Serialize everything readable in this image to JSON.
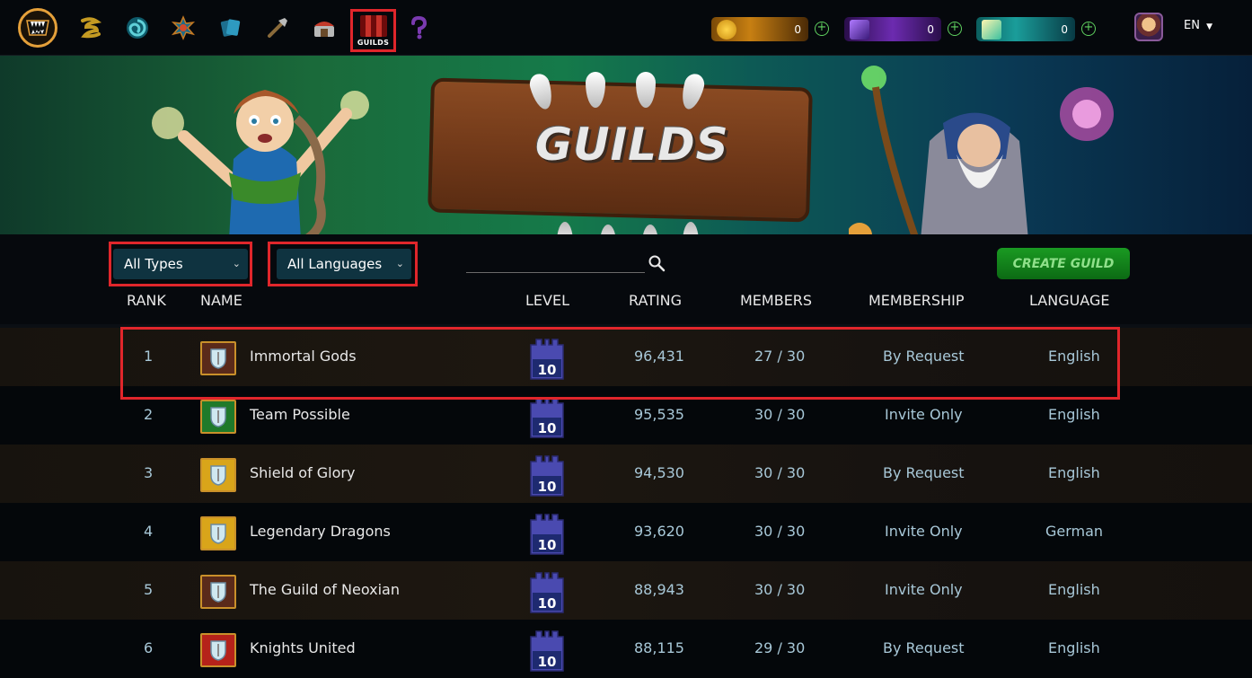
{
  "nav": {
    "items": [
      "logo-icon",
      "quests-icon",
      "portal-icon",
      "battle-icon",
      "cards-icon",
      "tools-icon",
      "shop-icon",
      "guilds",
      "help-icon"
    ],
    "guilds_label": "GUILDS"
  },
  "currencies": [
    {
      "name": "gold-currency",
      "value": "0",
      "color": "#c77f12"
    },
    {
      "name": "purple-currency",
      "value": "0",
      "color": "#6c2bb0"
    },
    {
      "name": "teal-currency",
      "value": "0",
      "color": "#1a9d9a"
    }
  ],
  "language_selector": "EN",
  "banner": {
    "title": "GUILDS"
  },
  "filters": {
    "type": "All Types",
    "language": "All Languages",
    "search_placeholder": "",
    "create_button": "CREATE GUILD"
  },
  "columns": {
    "rank": "RANK",
    "name": "NAME",
    "level": "LEVEL",
    "rating": "RATING",
    "members": "MEMBERS",
    "membership": "MEMBERSHIP",
    "language": "LANGUAGE"
  },
  "guilds": [
    {
      "rank": "1",
      "name": "Immortal Gods",
      "level": "10",
      "rating": "96,431",
      "members": "27 / 30",
      "membership": "By Request",
      "language": "English",
      "crest_color": "#5a2a1a"
    },
    {
      "rank": "2",
      "name": "Team Possible",
      "level": "10",
      "rating": "95,535",
      "members": "30 / 30",
      "membership": "Invite Only",
      "language": "English",
      "crest_color": "#1f7a2a"
    },
    {
      "rank": "3",
      "name": "Shield of Glory",
      "level": "10",
      "rating": "94,530",
      "members": "30 / 30",
      "membership": "By Request",
      "language": "English",
      "crest_color": "#d9a51a"
    },
    {
      "rank": "4",
      "name": "Legendary Dragons",
      "level": "10",
      "rating": "93,620",
      "members": "30 / 30",
      "membership": "Invite Only",
      "language": "German",
      "crest_color": "#d9a51a"
    },
    {
      "rank": "5",
      "name": "The Guild of Neoxian",
      "level": "10",
      "rating": "88,943",
      "members": "30 / 30",
      "membership": "Invite Only",
      "language": "English",
      "crest_color": "#5a2a1a"
    },
    {
      "rank": "6",
      "name": "Knights United",
      "level": "10",
      "rating": "88,115",
      "members": "29 / 30",
      "membership": "By Request",
      "language": "English",
      "crest_color": "#b5221a"
    }
  ],
  "colors": {
    "highlight": "#e0262b",
    "accent": "#1a9a22"
  }
}
